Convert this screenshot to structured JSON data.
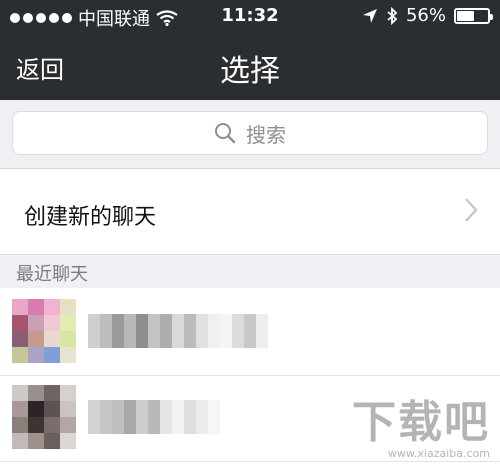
{
  "status_bar": {
    "carrier": "中国联通",
    "time": "11:32",
    "battery_percent": "56%",
    "battery_level": 0.56,
    "signal_dots": 5,
    "icons": [
      "signal-dots-icon",
      "wifi-icon",
      "location-arrow-icon",
      "bluetooth-icon",
      "battery-icon"
    ]
  },
  "nav": {
    "back_label": "返回",
    "title": "选择"
  },
  "search": {
    "placeholder": "搜索",
    "icon": "search-icon"
  },
  "new_chat": {
    "label": "创建新的聊天",
    "icon": "chevron-right-icon"
  },
  "section": {
    "recent_label": "最近聊天"
  },
  "contacts": [
    {
      "avatar_colors": [
        "#e8a7c6",
        "#d97bb1",
        "#f2b3d0",
        "#e6e1c5",
        "#a8536f",
        "#c9a0b6",
        "#f0c8d8",
        "#e2ecb0",
        "#8a5e73",
        "#c79a8e",
        "#e9d9cf",
        "#d6e6a0",
        "#c6c69a",
        "#a9a3c7",
        "#7f9fd8",
        "#e8e4cf"
      ],
      "name_blur_colors": [
        "#cfcfcf",
        "#bdbdbd",
        "#9a9a9a",
        "#b8b8b8",
        "#8e8e8e",
        "#c4c4c4",
        "#adadad",
        "#d9d9d9",
        "#bbbbbb",
        "#e0e0e0",
        "#f0f0f0",
        "#f4f4f4",
        "#dcdcdc",
        "#c8c8c8",
        "#ededed"
      ]
    },
    {
      "avatar_colors": [
        "#cfc9c6",
        "#9b8f8d",
        "#6e6462",
        "#d6d1cf",
        "#a79a96",
        "#2b2526",
        "#5e5352",
        "#c9c4c2",
        "#8b7f7c",
        "#3e3434",
        "#7a6d6b",
        "#b1a8a5",
        "#c2bab7",
        "#9d908d",
        "#6b5f5d",
        "#dbd7d5"
      ],
      "name_blur_colors": [
        "#d2d2d2",
        "#c6c6c6",
        "#bfbfbf",
        "#a8a8a8",
        "#cdcdcd",
        "#b9b9b9",
        "#e6e6e6",
        "#f2f2f2",
        "#dedede",
        "#ececec",
        "#f6f6f6"
      ]
    }
  ],
  "watermark": {
    "big": "下载吧",
    "small": "www.xiazaiba.com"
  },
  "colors": {
    "header_bg": "#2a2e31",
    "page_bg": "#efeff4"
  }
}
